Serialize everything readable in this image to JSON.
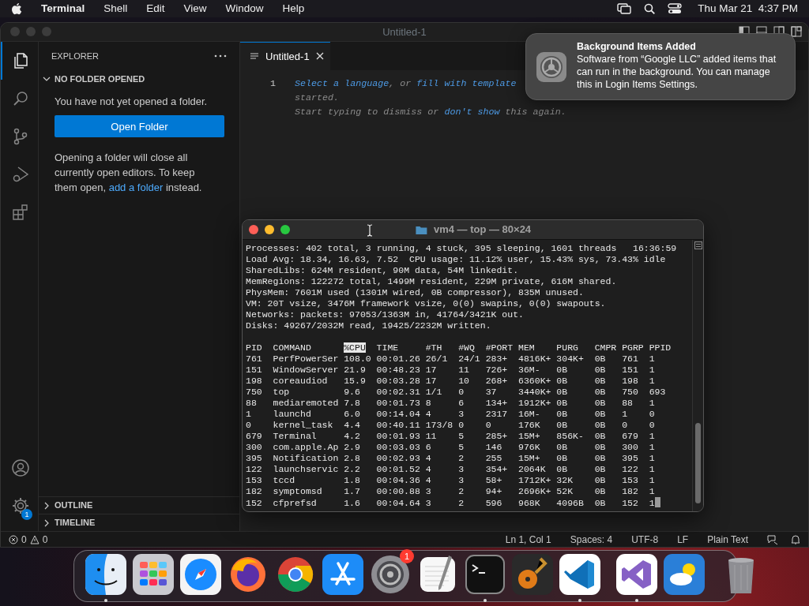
{
  "menubar": {
    "app": "Terminal",
    "items": [
      "Shell",
      "Edit",
      "View",
      "Window",
      "Help"
    ],
    "clock": "Thu Mar 21  4:37 PM"
  },
  "vscode": {
    "title": "Untitled-1",
    "activity": [
      {
        "kind": "files",
        "selected": true
      },
      {
        "kind": "search",
        "selected": false
      },
      {
        "kind": "source-control",
        "selected": false
      },
      {
        "kind": "run-debug",
        "selected": false
      },
      {
        "kind": "extensions",
        "selected": false
      }
    ],
    "settings_badge": "1",
    "explorer": {
      "title": "EXPLORER",
      "section": "NO FOLDER OPENED",
      "expanded": true,
      "message": "You have not yet opened a folder.",
      "button": "Open Folder",
      "note": [
        {
          "kind": "text",
          "text": "Opening a folder will close all currently open editors. To keep them open, "
        },
        {
          "kind": "link",
          "text": "add a folder"
        },
        {
          "kind": "text",
          "text": " instead."
        }
      ]
    },
    "panels": [
      {
        "label": "OUTLINE",
        "expanded": false
      },
      {
        "label": "TIMELINE",
        "expanded": false
      }
    ],
    "tab": {
      "label": "Untitled-1",
      "selected": true
    },
    "line_number": "1",
    "lines": [
      [
        {
          "kind": "link",
          "text": "Select a language"
        },
        {
          "kind": "text",
          "text": ", or "
        },
        {
          "kind": "link",
          "text": "fill with template"
        }
      ],
      [
        {
          "kind": "text",
          "text": "started."
        }
      ],
      [
        {
          "kind": "text",
          "text": "Start typing to dismiss or "
        },
        {
          "kind": "link",
          "text": "don't show"
        },
        {
          "kind": "text",
          "text": " this again."
        }
      ]
    ],
    "status": {
      "errors": "0",
      "warnings": "0",
      "items": [
        "Ln 1, Col 1",
        "Spaces: 4",
        "UTF-8",
        "LF",
        "Plain Text"
      ]
    }
  },
  "terminal": {
    "title": "vm4 — top — 80×24",
    "summary": [
      "Processes: 402 total, 3 running, 4 stuck, 395 sleeping, 1601 threads   16:36:59",
      "Load Avg: 18.34, 16.63, 7.52  CPU usage: 11.12% user, 15.43% sys, 73.43% idle",
      "SharedLibs: 624M resident, 90M data, 54M linkedit.",
      "MemRegions: 122272 total, 1499M resident, 229M private, 616M shared.",
      "PhysMem: 7601M used (1301M wired, 0B compressor), 835M unused.",
      "VM: 20T vsize, 3476M framework vsize, 0(0) swapins, 0(0) swapouts.",
      "Networks: packets: 97053/1363M in, 41764/3421K out.",
      "Disks: 49267/2032M read, 19425/2232M written."
    ],
    "columns": [
      {
        "label": "PID",
        "sorted": false
      },
      {
        "label": "COMMAND",
        "sorted": false
      },
      {
        "label": "%CPU",
        "sorted": true
      },
      {
        "label": "TIME",
        "sorted": false
      },
      {
        "label": "#TH",
        "sorted": false
      },
      {
        "label": "#WQ",
        "sorted": false
      },
      {
        "label": "#PORT",
        "sorted": false
      },
      {
        "label": "MEM",
        "sorted": false
      },
      {
        "label": "PURG",
        "sorted": false
      },
      {
        "label": "CMPR",
        "sorted": false
      },
      {
        "label": "PGRP",
        "sorted": false
      },
      {
        "label": "PPID",
        "sorted": false
      }
    ],
    "rows": [
      [
        "761",
        "PerfPowerSer",
        "108.0",
        "00:01.26",
        "26/1",
        "24/1",
        "283+",
        "4816K+",
        "304K+",
        "0B",
        "761",
        "1"
      ],
      [
        "151",
        "WindowServer",
        "21.9",
        "00:48.23",
        "17",
        "11",
        "726+",
        "36M-",
        "0B",
        "0B",
        "151",
        "1"
      ],
      [
        "198",
        "coreaudiod",
        "15.9",
        "00:03.28",
        "17",
        "10",
        "268+",
        "6360K+",
        "0B",
        "0B",
        "198",
        "1"
      ],
      [
        "750",
        "top",
        "9.6",
        "00:02.31",
        "1/1",
        "0",
        "37",
        "3440K+",
        "0B",
        "0B",
        "750",
        "693"
      ],
      [
        "88",
        "mediaremoted",
        "7.8",
        "00:01.73",
        "8",
        "6",
        "134+",
        "1912K+",
        "0B",
        "0B",
        "88",
        "1"
      ],
      [
        "1",
        "launchd",
        "6.0",
        "00:14.04",
        "4",
        "3",
        "2317",
        "16M-",
        "0B",
        "0B",
        "1",
        "0"
      ],
      [
        "0",
        "kernel_task",
        "4.4",
        "00:40.11",
        "173/8",
        "0",
        "0",
        "176K",
        "0B",
        "0B",
        "0",
        "0"
      ],
      [
        "679",
        "Terminal",
        "4.2",
        "00:01.93",
        "11",
        "5",
        "285+",
        "15M+",
        "856K-",
        "0B",
        "679",
        "1"
      ],
      [
        "300",
        "com.apple.Ap",
        "2.9",
        "00:03.03",
        "6",
        "5",
        "146",
        "976K",
        "0B",
        "0B",
        "300",
        "1"
      ],
      [
        "395",
        "Notification",
        "2.8",
        "00:02.93",
        "4",
        "2",
        "255",
        "15M+",
        "0B",
        "0B",
        "395",
        "1"
      ],
      [
        "122",
        "launchservic",
        "2.2",
        "00:01.52",
        "4",
        "3",
        "354+",
        "2064K",
        "0B",
        "0B",
        "122",
        "1"
      ],
      [
        "153",
        "tccd",
        "1.8",
        "00:04.36",
        "4",
        "3",
        "58+",
        "1712K+",
        "32K",
        "0B",
        "153",
        "1"
      ],
      [
        "182",
        "symptomsd",
        "1.7",
        "00:00.88",
        "3",
        "2",
        "94+",
        "2696K+",
        "52K",
        "0B",
        "182",
        "1"
      ],
      [
        "152",
        "cfprefsd",
        "1.6",
        "00:04.64",
        "3",
        "2",
        "596",
        "968K",
        "4096B",
        "0B",
        "152",
        "1"
      ]
    ]
  },
  "notification": {
    "title": "Background Items Added",
    "body": "Software from “Google LLC” added items that can run in the background. You can manage this in Login Items Settings."
  },
  "dock": [
    {
      "kind": "finder",
      "running": true
    },
    {
      "kind": "launchpad",
      "running": false
    },
    {
      "kind": "safari",
      "running": false
    },
    {
      "kind": "firefox",
      "running": false
    },
    {
      "kind": "chrome",
      "running": false
    },
    {
      "kind": "appstore",
      "running": false
    },
    {
      "kind": "settings",
      "running": false,
      "badge": "1"
    },
    {
      "kind": "textedit",
      "running": false
    },
    {
      "kind": "terminal",
      "running": true
    },
    {
      "kind": "garageband",
      "running": false
    },
    {
      "kind": "vscode",
      "running": true
    },
    {
      "kind": "separator"
    },
    {
      "kind": "visualstudio",
      "running": true
    },
    {
      "kind": "weather",
      "running": false
    },
    {
      "kind": "separator"
    },
    {
      "kind": "trash",
      "running": false
    }
  ]
}
